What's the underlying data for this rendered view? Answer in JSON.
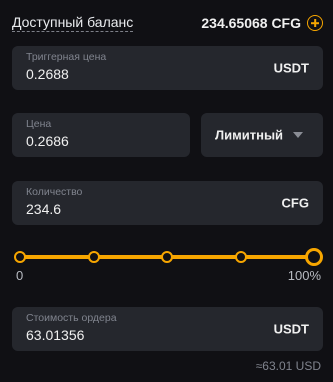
{
  "balance": {
    "label": "Доступный баланс",
    "value": "234.65068 CFG",
    "add_icon": "plus-circle-icon"
  },
  "trigger": {
    "label": "Триггерная цена",
    "value": "0.2688",
    "unit": "USDT"
  },
  "price": {
    "label": "Цена",
    "value": "0.2686"
  },
  "order_type": {
    "selected": "Лимитный",
    "icon": "caret-down-icon"
  },
  "quantity": {
    "label": "Количество",
    "value": "234.6",
    "unit": "CFG"
  },
  "slider": {
    "min_label": "0",
    "max_label": "100%",
    "value_percent": 100,
    "marks_percent": [
      0,
      25,
      50,
      75,
      100
    ]
  },
  "order_cost": {
    "label": "Стоимость ордера",
    "value": "63.01356",
    "unit": "USDT"
  },
  "approx": "≈63.01 USD",
  "colors": {
    "accent": "#f7a600",
    "background": "#101014",
    "field": "#25272d",
    "muted": "#80848e"
  }
}
